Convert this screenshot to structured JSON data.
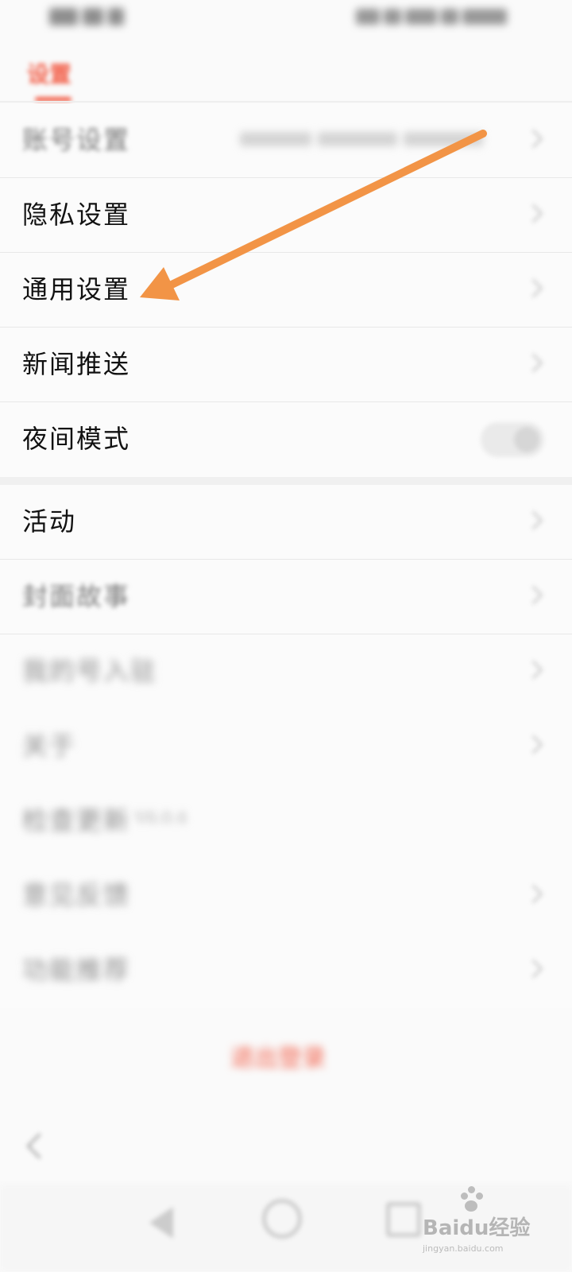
{
  "header": {
    "tab_label": "设置"
  },
  "settings": [
    {
      "label": "账号设置",
      "detail": "已绑定微信、新浪微博、QQ登录"
    },
    {
      "label": "隐私设置"
    },
    {
      "label": "通用设置"
    },
    {
      "label": "新闻推送"
    },
    {
      "label": "夜间模式",
      "toggle": "off"
    }
  ],
  "more": [
    {
      "label": "活动"
    },
    {
      "label": "封面故事"
    },
    {
      "label": "我的号入驻"
    },
    {
      "label": "关于"
    },
    {
      "label": "检查更新",
      "detail": "V6.0.4"
    },
    {
      "label": "意见反馈"
    },
    {
      "label": "功能推荐"
    }
  ],
  "logout_label": "退出登录",
  "watermark": {
    "brand": "Baidu经验",
    "url": "jingyan.baidu.com"
  },
  "colors": {
    "accent": "#f2614b",
    "annotation_arrow": "#f29446"
  },
  "icons": [
    "chevron-right-icon",
    "back-icon",
    "nav-back-icon",
    "nav-home-icon",
    "nav-recent-icon",
    "paw-icon"
  ]
}
